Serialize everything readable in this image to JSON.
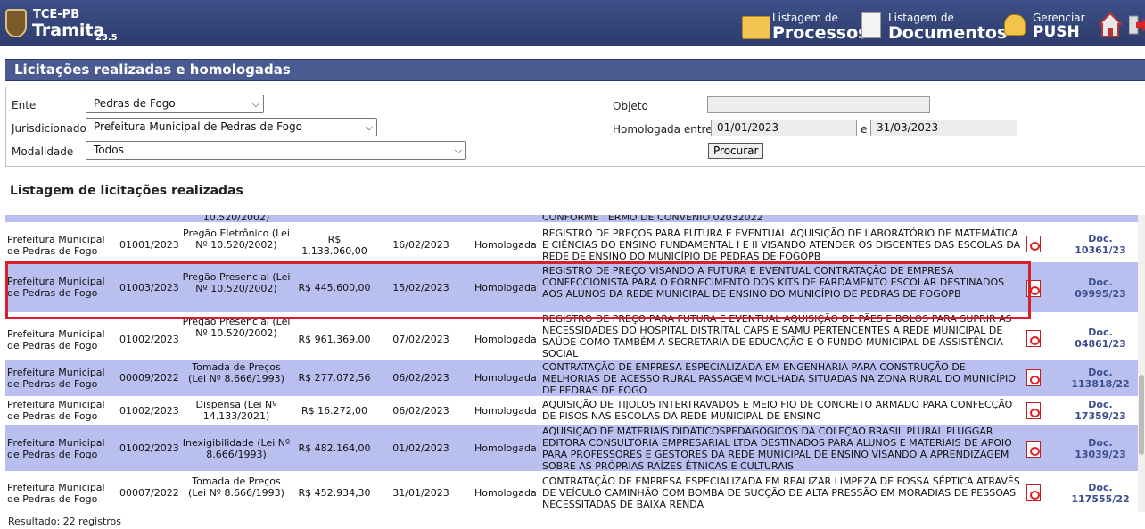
{
  "header": {
    "brand_top": "TCE-PB",
    "brand_name": "Tramita",
    "version": "23.5",
    "nav": [
      {
        "small": "Listagem de",
        "big": "Processos",
        "icon": "folder-icon"
      },
      {
        "small": "Listagem de",
        "big": "Documentos",
        "icon": "document-icon"
      },
      {
        "small": "Gerenciar",
        "big": "PUSH",
        "icon": "bell-icon"
      }
    ],
    "home_icon": "home-icon",
    "exit_icon": "exit-icon"
  },
  "page": {
    "title": "Licitações realizadas e homologadas",
    "list_title": "Listagem de licitações realizadas",
    "result": "Resultado: 22 registros"
  },
  "form": {
    "ente_label": "Ente",
    "ente_value": "Pedras de Fogo",
    "jurisdicionado_label": "Jurisdicionado",
    "jurisdicionado_value": "Prefeitura Municipal de Pedras de Fogo",
    "modalidade_label": "Modalidade",
    "modalidade_value": "Todos",
    "objeto_label": "Objeto",
    "objeto_value": "",
    "homologada_label": "Homologada entre",
    "date_from": "01/01/2023",
    "date_sep": "e",
    "date_to": "31/03/2023",
    "search_button": "Procurar"
  },
  "table": {
    "partial_top": {
      "modalidade": "10.520/2002)",
      "objeto": "CONFORME TERMO DE CONVÊNIO 02032022"
    },
    "rows": [
      {
        "ente": "Prefeitura Municipal de Pedras de Fogo",
        "numero": "01001/2023",
        "modalidade": "Pregão Eletrônico (Lei Nº 10.520/2002)",
        "valor": "R$ 1.138.060,00",
        "data": "16/02/2023",
        "situacao": "Homologada",
        "objeto": "REGISTRO DE PREÇOS PARA FUTURA E EVENTUAL AQUISIÇÃO DE LABORATÓRIO DE MATEMÁTICA E CIÊNCIAS DO ENSINO FUNDAMENTAL I E II VISANDO ATENDER OS DISCENTES DAS ESCOLAS DA REDE DE ENSINO DO MUNICÍPIO DE PEDRAS DE FOGOPB",
        "doc_prefix": "Doc.",
        "doc": "10361/23"
      },
      {
        "ente": "Prefeitura Municipal de Pedras de Fogo",
        "numero": "01003/2023",
        "modalidade": "Pregão Presencial (Lei Nº 10.520/2002)",
        "valor": "R$ 445.600,00",
        "data": "15/02/2023",
        "situacao": "Homologada",
        "objeto": "REGISTRO DE PREÇO VISANDO A FUTURA E EVENTUAL CONTRATAÇÃO DE EMPRESA CONFECCIONISTA PARA O FORNECIMENTO DOS KITS DE FARDAMENTO ESCOLAR DESTINADOS AOS ALUNOS DA REDE MUNICIPAL DE ENSINO DO MUNICÍPIO DE PEDRAS DE FOGOPB",
        "doc_prefix": "Doc.",
        "doc": "09995/23"
      },
      {
        "ente": "Prefeitura Municipal de Pedras de Fogo",
        "numero": "01002/2023",
        "modalidade": "Pregão Presencial (Lei Nº 10.520/2002)",
        "valor": "R$ 961.369,00",
        "data": "07/02/2023",
        "situacao": "Homologada",
        "objeto": "REGISTRO DE PREÇO PARA FUTURA E EVENTUAL AQUISIÇÃO DE PÃES E BOLOS PARA SUPRIR AS NECESSIDADES DO HOSPITAL DISTRITAL CAPS E SAMU PERTENCENTES A REDE MUNICIPAL DE SAÚDE COMO TAMBÉM A SECRETARIA DE EDUCAÇÃO E O FUNDO MUNICIPAL DE ASSISTÊNCIA SOCIAL",
        "doc_prefix": "Doc.",
        "doc": "04861/23"
      },
      {
        "ente": "Prefeitura Municipal de Pedras de Fogo",
        "numero": "00009/2022",
        "modalidade": "Tomada de Preços (Lei Nº 8.666/1993)",
        "valor": "R$ 277.072,56",
        "data": "06/02/2023",
        "situacao": "Homologada",
        "objeto": "CONTRATAÇÃO DE EMPRESA ESPECIALIZADA EM ENGENHARIA PARA CONSTRUÇÃO DE MELHORIAS DE ACESSO RURAL PASSAGEM MOLHADA SITUADAS NA ZONA RURAL DO MUNICÍPIO DE PEDRAS DE FOGO",
        "doc_prefix": "Doc.",
        "doc": "113818/22"
      },
      {
        "ente": "Prefeitura Municipal de Pedras de Fogo",
        "numero": "01002/2023",
        "modalidade": "Dispensa (Lei Nº 14.133/2021)",
        "valor": "R$ 16.272,00",
        "data": "06/02/2023",
        "situacao": "Homologada",
        "objeto": "AQUISIÇÃO DE TIJOLOS INTERTRAVADOS E MEIO FIO DE CONCRETO ARMADO PARA CONFECÇÃO DE PISOS NAS ESCOLAS DA REDE MUNICIPAL DE ENSINO",
        "doc_prefix": "Doc.",
        "doc": "17359/23"
      },
      {
        "ente": "Prefeitura Municipal de Pedras de Fogo",
        "numero": "01002/2023",
        "modalidade": "Inexigibilidade (Lei Nº 8.666/1993)",
        "valor": "R$ 482.164,00",
        "data": "01/02/2023",
        "situacao": "Homologada",
        "objeto": "AQUISIÇÃO DE MATERIAIS DIDÁTICOSPEDAGÓGICOS DA COLEÇÃO BRASIL PLURAL PLUGGAR EDITORA CONSULTORIA EMPRESARIAL LTDA DESTINADOS PARA ALUNOS E MATERIAIS DE APOIO PARA PROFESSORES E GESTORES DA REDE MUNICIPAL DE ENSINO VISANDO A APRENDIZAGEM SOBRE AS PRÓPRIAS RAÍZES ÉTNICAS E CULTURAIS",
        "doc_prefix": "Doc.",
        "doc": "13039/23"
      },
      {
        "ente": "Prefeitura Municipal de Pedras de Fogo",
        "numero": "00007/2022",
        "modalidade": "Tomada de Preços (Lei Nº 8.666/1993)",
        "valor": "R$ 452.934,30",
        "data": "31/01/2023",
        "situacao": "Homologada",
        "objeto": "CONTRATAÇÃO DE EMPRESA ESPECIALIZADA EM REALIZAR LIMPEZA DE FOSSA SÉPTICA ATRAVÉS DE VEÍCULO CAMINHÃO COM BOMBA DE SUCÇÃO DE ALTA PRESSÃO EM MORADIAS DE PESSOAS NECESSITADAS DE BAIXA RENDA",
        "doc_prefix": "Doc.",
        "doc": "117555/22"
      }
    ]
  }
}
